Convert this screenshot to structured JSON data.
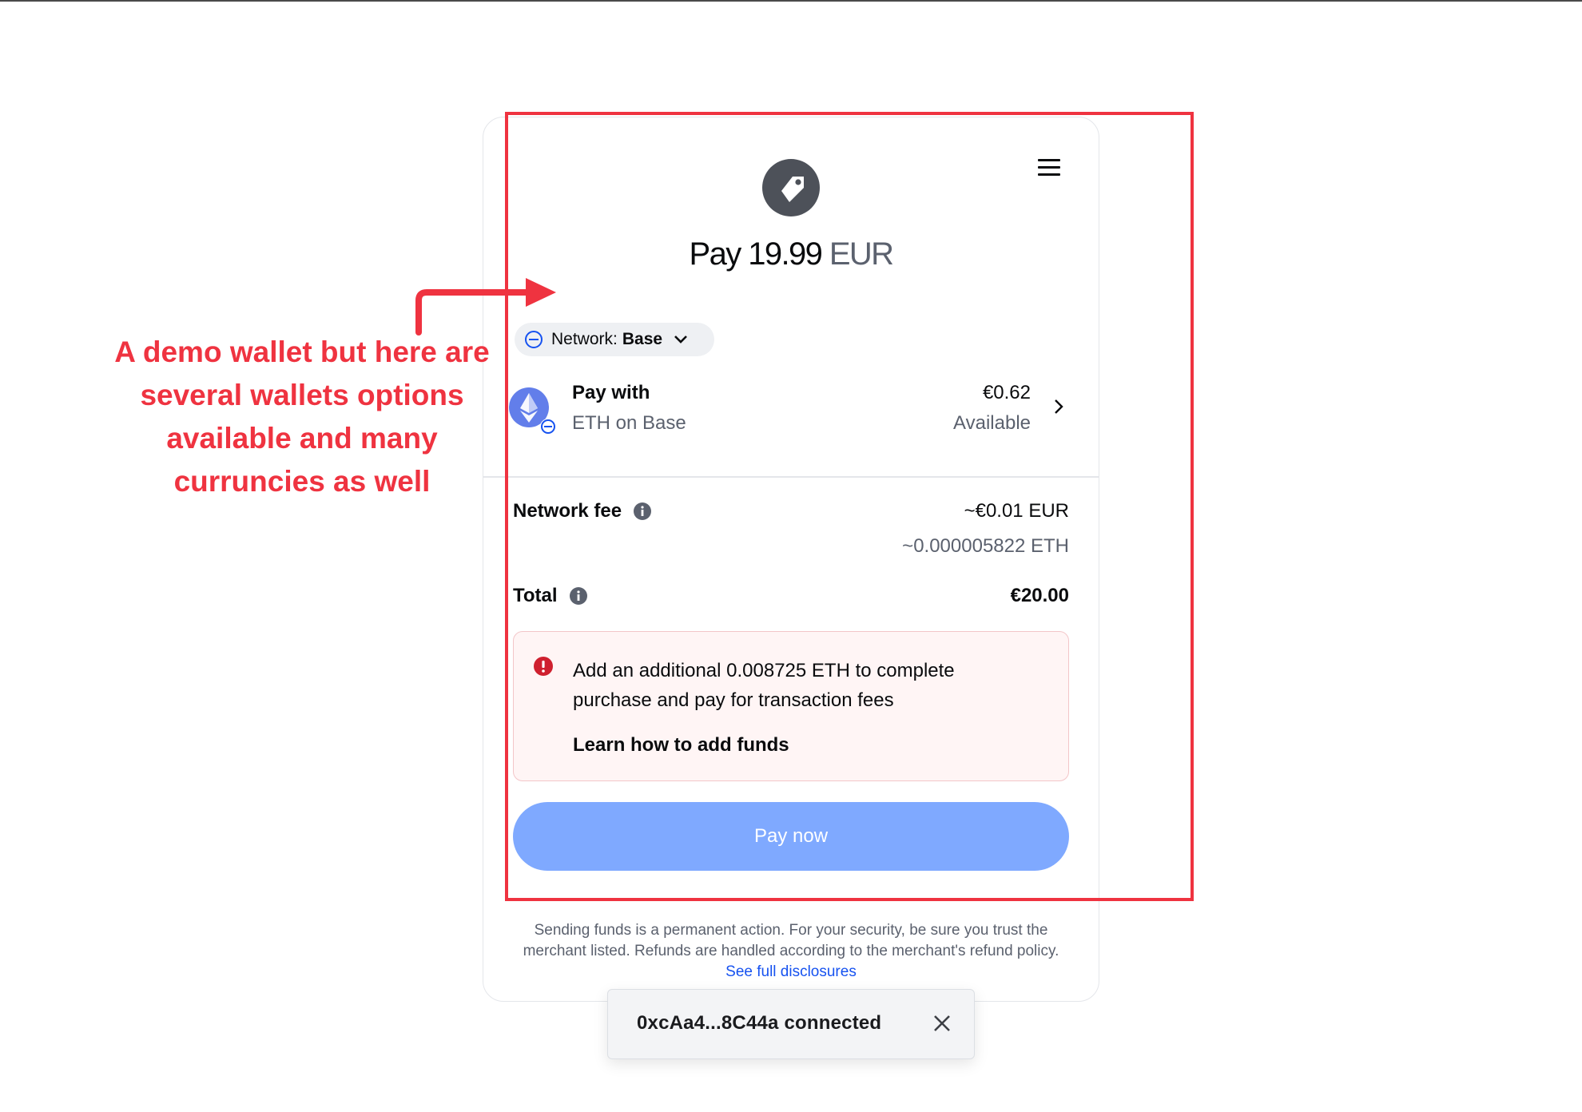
{
  "header": {
    "menu_icon": "hamburger-menu-icon",
    "merchant_icon": "price-tag-icon",
    "title_prefix": "Pay",
    "amount": "19.99",
    "currency": "EUR"
  },
  "network": {
    "label": "Network:",
    "value": "Base",
    "icon": "base-network-icon",
    "chevron_icon": "chevron-down-icon"
  },
  "pay_with": {
    "label": "Pay with",
    "asset": "ETH on Base",
    "balance": "€0.62",
    "balance_label": "Available",
    "asset_icon": "ethereum-icon",
    "chevron_icon": "chevron-right-icon"
  },
  "fees": {
    "network_fee_label": "Network fee",
    "network_fee_value": "~€0.01 EUR",
    "network_fee_eth": "~0.000005822 ETH",
    "total_label": "Total",
    "total_value": "€20.00",
    "info_icon": "info-icon"
  },
  "alert": {
    "icon": "error-icon",
    "message": "Add an additional 0.008725 ETH to complete purchase and pay for transaction fees",
    "link": "Learn how to add funds"
  },
  "pay_button": {
    "label": "Pay now"
  },
  "disclosure": {
    "text": "Sending funds is a permanent action. For your security, be sure you trust the merchant listed. Refunds are handled according to the merchant's refund policy.",
    "link": "See full disclosures"
  },
  "toast": {
    "text": "0xcAa4...8C44a connected",
    "close_icon": "close-icon"
  },
  "annotation": {
    "text": "A demo wallet but here are several wallets options available and many currunc­ies as well",
    "color": "#ef3340"
  },
  "colors": {
    "accent_blue": "#1652f0",
    "button_blue": "#7fa9ff",
    "alert_red": "#cf202f",
    "annotation_red": "#ef3340"
  }
}
